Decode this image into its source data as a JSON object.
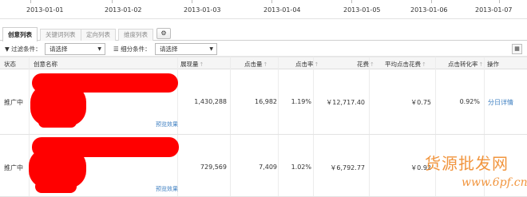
{
  "date_axis": {
    "dates": [
      "2013-01-01",
      "2013-01-02",
      "2013-01-03",
      "2013-01-04",
      "2013-01-05",
      "2013-01-06",
      "2013-01-07"
    ]
  },
  "tabs": [
    {
      "label": "创意列表",
      "active": true
    },
    {
      "label": "关键词列表",
      "active": false
    },
    {
      "label": "定向列表",
      "active": false
    },
    {
      "label": "维度列表",
      "active": false
    }
  ],
  "filter_bar": {
    "filter_label": "过滤条件：",
    "filter_value": "请选择",
    "segment_label": "细分条件：",
    "segment_value": "请选择"
  },
  "table": {
    "columns": [
      "状态",
      "创意名称",
      "展现量",
      "点击量",
      "点击率",
      "花费",
      "平均点击花费",
      "点击转化率",
      "操作"
    ],
    "rows": [
      {
        "status": "推广中",
        "preview": "预览效果",
        "impressions": "1,430,288",
        "clicks": "16,982",
        "ctr": "1.19%",
        "cost": "￥12,717.40",
        "avg_cpc": "￥0.75",
        "conv_rate": "0.92%",
        "action": "分日详情"
      },
      {
        "status": "推广中",
        "preview": "预览效果",
        "impressions": "729,569",
        "clicks": "7,409",
        "ctr": "1.02%",
        "cost": "￥6,792.77",
        "avg_cpc": "￥0.92",
        "conv_rate": "",
        "action": ""
      }
    ]
  },
  "watermark": {
    "line1": "货源批发网",
    "line2": "www.6pf.cn"
  },
  "colors": {
    "link": "#3e7fc1",
    "redaction": "#ff0000",
    "watermark": "#f08a2a"
  }
}
